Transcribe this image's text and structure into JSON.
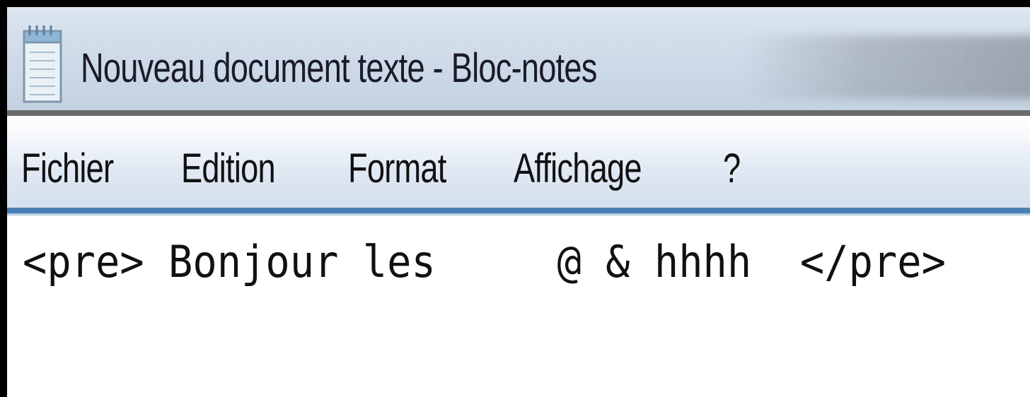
{
  "window": {
    "title": "Nouveau document texte - Bloc-notes"
  },
  "menu": {
    "items": [
      "Fichier",
      "Edition",
      "Format",
      "Affichage",
      "?"
    ]
  },
  "editor": {
    "content": "<pre> Bonjour les     @ & hhhh  </pre>"
  },
  "icons": {
    "app": "notepad-icon"
  },
  "colors": {
    "menu_separator": "#4a7fb5",
    "title_background": "#cfdbe8",
    "menu_background": "#dfe8f3",
    "text": "#111111"
  }
}
